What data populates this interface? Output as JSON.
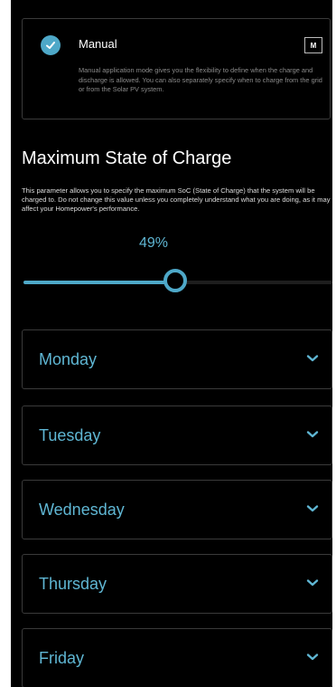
{
  "mode": {
    "title": "Manual",
    "badge": "M",
    "description": "Manual application mode gives you the flexibility to define when the charge and discharge is allowed. You can also separately specify when to charge from the grid or from the Solar PV system."
  },
  "soc": {
    "title": "Maximum State of Charge",
    "description": "This parameter allows you to specify the maximum SoC (State of Charge) that the system will be charged to. Do not change this value unless you completely understand what you are doing, as it may affect your Homepower's performance.",
    "value_label": "49%",
    "value": 49
  },
  "days": [
    {
      "label": "Monday"
    },
    {
      "label": "Tuesday"
    },
    {
      "label": "Wednesday"
    },
    {
      "label": "Thursday"
    },
    {
      "label": "Friday"
    }
  ],
  "colors": {
    "accent": "#4ea8c8",
    "background": "#000000",
    "border": "#3a3a3a"
  },
  "icons": {
    "check": "check-icon",
    "chevron": "chevron-down-icon"
  }
}
